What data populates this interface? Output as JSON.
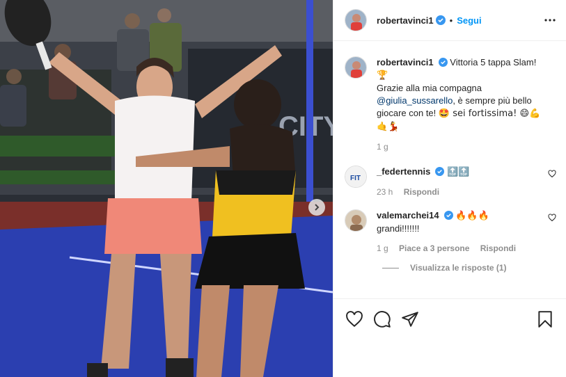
{
  "post": {
    "author": "robertavinci1",
    "follow_label": "Segui",
    "dot": "•"
  },
  "caption": {
    "author": "robertavinci1",
    "line1": "Vittoria 5 tappa Slam!",
    "emoji_trophy": "🏆",
    "line2a": "Grazie alla mia compagna",
    "mention": "@giulia_sussarello",
    "line2b": ", è sempre più bello giocare con te!",
    "emoji_line2": "🤩 sei fortissima! 😄💪",
    "emoji_line3": "🤙💃",
    "time": "1 g"
  },
  "comments": [
    {
      "author": "_federtennis",
      "text": "",
      "emoji": "🔝🔝",
      "time": "23 h",
      "likes": "",
      "reply_label": "Rispondi"
    },
    {
      "author": "valemarchei14",
      "text": "grandi!!!!!!!",
      "emoji": "🔥🔥🔥",
      "time": "1 g",
      "likes": "Piace a 3 persone",
      "reply_label": "Rispondi"
    }
  ],
  "view_replies": "Visualizza le risposte (1)",
  "photo": {
    "bg_text": "CITY"
  },
  "colors": {
    "accent": "#0095f6",
    "verified": "#3897f0",
    "court": "#2b3fb0",
    "shirt_pink": "#f08878"
  },
  "icons": [
    "more-icon",
    "heart-icon",
    "comment-icon",
    "share-icon",
    "bookmark-icon",
    "chevron-right-icon",
    "verified-icon"
  ]
}
